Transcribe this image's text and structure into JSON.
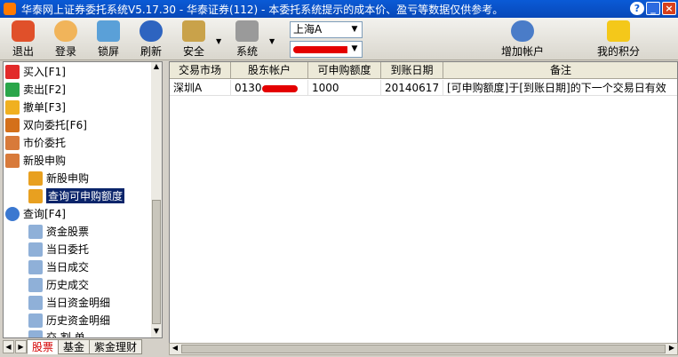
{
  "window": {
    "title": "华泰网上证券委托系统V5.17.30 - 华泰证券(112) - 本委托系统提示的成本价、盈亏等数据仅供参考。",
    "help": "?",
    "minimize": "_",
    "close": "×"
  },
  "toolbar": {
    "exit": "退出",
    "login": "登录",
    "lock": "锁屏",
    "refresh": "刷新",
    "security": "安全",
    "system": "系统",
    "market_value": "上海A",
    "account_value": "",
    "add_account": "增加帐户",
    "my_points": "我的积分",
    "dropdown_caret": "▼"
  },
  "tree": {
    "items": [
      {
        "label": "买入[F1]"
      },
      {
        "label": "卖出[F2]"
      },
      {
        "label": "撤单[F3]"
      },
      {
        "label": "双向委托[F6]"
      },
      {
        "label": "市价委托"
      },
      {
        "label": "新股申购"
      },
      {
        "label": "新股申购"
      },
      {
        "label": "查询可申购额度"
      },
      {
        "label": "查询[F4]"
      },
      {
        "label": "资金股票"
      },
      {
        "label": "当日委托"
      },
      {
        "label": "当日成交"
      },
      {
        "label": "历史成交"
      },
      {
        "label": "当日资金明细"
      },
      {
        "label": "历史资金明细"
      },
      {
        "label": "交 割 单"
      }
    ]
  },
  "bottom_tabs": [
    "股票",
    "基金",
    "紫金理财"
  ],
  "grid": {
    "headers": [
      "交易市场",
      "股东帐户",
      "可申购额度",
      "到账日期",
      "备注"
    ],
    "rows": [
      {
        "market": "深圳A",
        "account": "0130",
        "quota": "1000",
        "date": "20140617",
        "note": "[可申购额度]于[到账日期]的下一个交易日有效"
      }
    ]
  },
  "colors": {
    "title_bar": "#0a5ad6",
    "selection": "#0a246a",
    "redaction": "#e40000",
    "active_tab_text": "#d40000"
  }
}
